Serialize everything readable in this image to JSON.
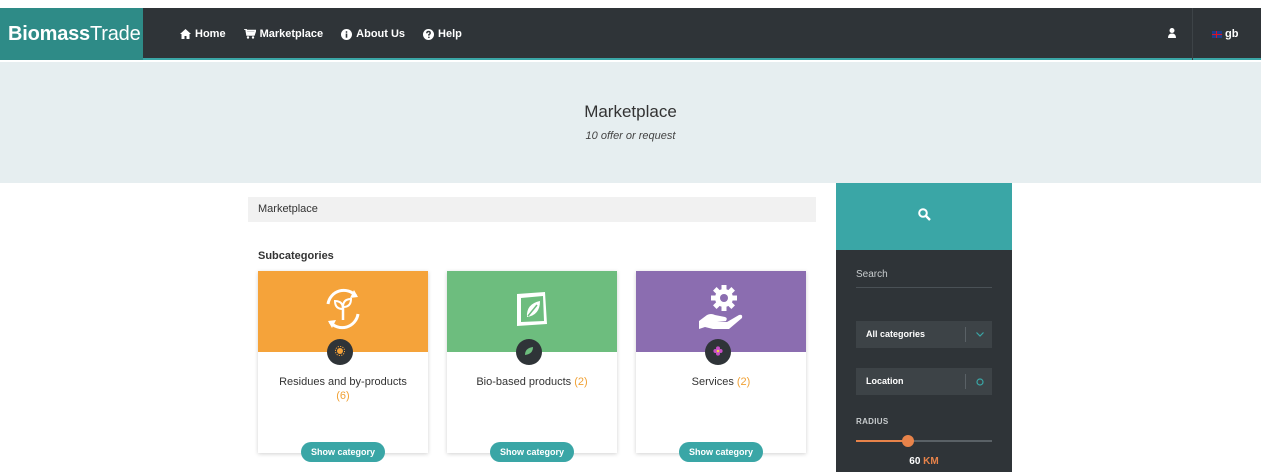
{
  "brand": {
    "bold": "Biomass",
    "light": "Trade"
  },
  "nav": {
    "items": [
      {
        "label": "Home",
        "icon": "home-icon"
      },
      {
        "label": "Marketplace",
        "icon": "cart-icon"
      },
      {
        "label": "About Us",
        "icon": "info-icon"
      },
      {
        "label": "Help",
        "icon": "question-icon"
      }
    ],
    "lang": "gb"
  },
  "hero": {
    "title": "Marketplace",
    "subtitle": "10 offer or request"
  },
  "breadcrumb": "Marketplace",
  "subcategories_title": "Subcategories",
  "cards": [
    {
      "name": "Residues and by-products",
      "count": "(6)",
      "button": "Show category",
      "color": "#f5a33a"
    },
    {
      "name": "Bio-based products",
      "count": "(2)",
      "button": "Show category",
      "color": "#6dbd7e"
    },
    {
      "name": "Services",
      "count": "(2)",
      "button": "Show category",
      "color": "#8b6db0"
    }
  ],
  "search_panel": {
    "search_label": "Search",
    "category_select": "All categories",
    "location_select": "Location",
    "radius_label": "RADIUS",
    "radius_value": "60",
    "radius_unit": "KM"
  },
  "colors": {
    "teal": "#3aa6a6",
    "dark": "#2f3438",
    "orange_accent": "#e8834a"
  }
}
